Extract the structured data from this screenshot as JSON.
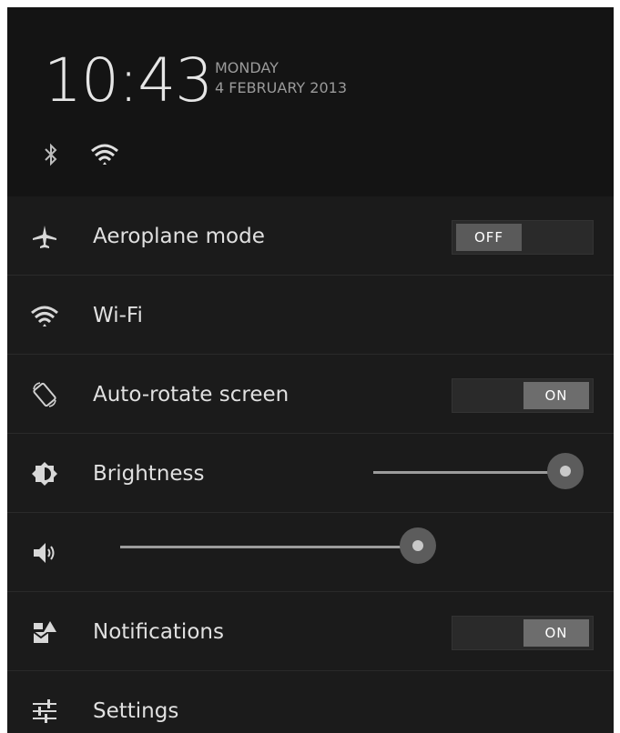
{
  "clock": {
    "time": "10:43",
    "day": "MONDAY",
    "date": "4 FEBRUARY 2013"
  },
  "status_icons": [
    "bluetooth-icon",
    "wifi-icon"
  ],
  "quick_settings": {
    "aeroplane": {
      "label": "Aeroplane mode",
      "state": "OFF"
    },
    "wifi": {
      "label": "Wi-Fi"
    },
    "autorotate": {
      "label": "Auto-rotate screen",
      "state": "ON"
    },
    "brightness": {
      "label": "Brightness",
      "level": 0.97
    },
    "volume": {
      "level": 0.88
    },
    "notifications": {
      "label": "Notifications",
      "state": "ON"
    },
    "settings": {
      "label": "Settings"
    }
  },
  "colors": {
    "panel_bg": "#171717",
    "row_bg": "#1b1b1b",
    "text": "#e0e0e0",
    "date_text": "#9a9a9a"
  }
}
